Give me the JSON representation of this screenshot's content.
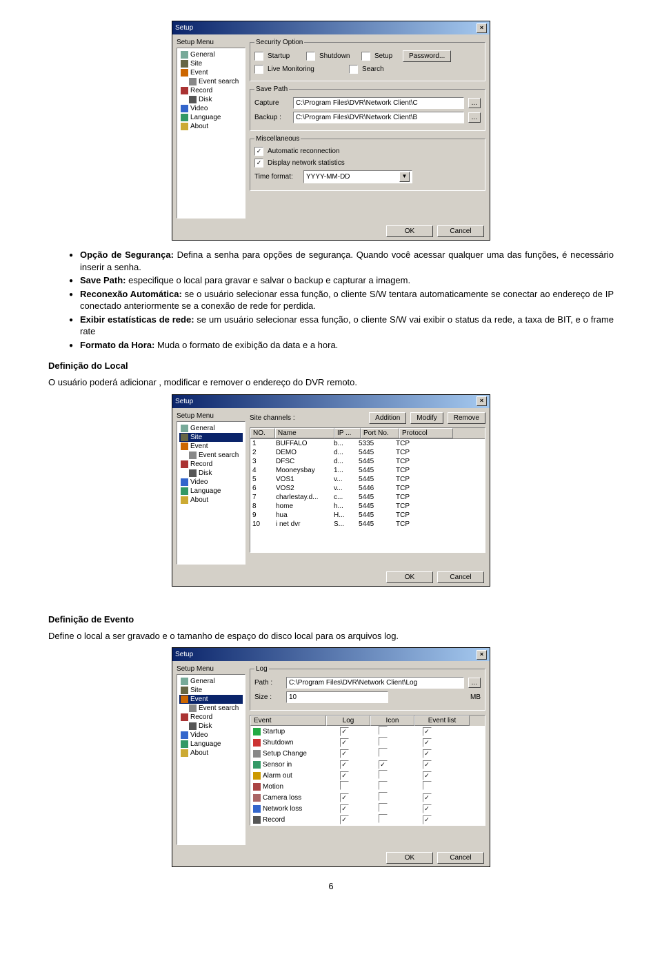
{
  "dialog_title": "Setup",
  "setup_menu_label": "Setup Menu",
  "menu_items": [
    "General",
    "Site",
    "Event",
    "Event search",
    "Record",
    "Disk",
    "Video",
    "Language",
    "About"
  ],
  "d1": {
    "security_legend": "Security Option",
    "startup": "Startup",
    "shutdown": "Shutdown",
    "setup": "Setup",
    "password_btn": "Password...",
    "live_mon": "Live Monitoring",
    "search": "Search",
    "savepath_legend": "Save Path",
    "capture": "Capture",
    "capture_path": "C:\\Program Files\\DVR\\Network Client\\C",
    "backup": "Backup :",
    "backup_path": "C:\\Program Files\\DVR\\Network Client\\B",
    "misc_legend": "Miscellaneous",
    "auto_recon": "Automatic reconnection",
    "disp_net": "Display network statistics",
    "time_fmt_label": "Time format:",
    "time_fmt_val": "YYYY-MM-DD",
    "ok": "OK",
    "cancel": "Cancel",
    "browse": "..."
  },
  "bullets": {
    "b1_head": "Opção de Segurança:",
    "b1_text": " Defina a senha para opções de segurança. Quando você acessar qualquer uma das funções, é necessário inserir a senha.",
    "b2_head": "Save Path:",
    "b2_text": " especifique o local para gravar e salvar o backup e capturar a imagem.",
    "b3_head": "Reconexão Automática:",
    "b3_text": " se o usuário selecionar essa função, o cliente S/W tentara automaticamente se conectar ao endereço de IP conectado anteriormente se a conexão de rede for perdida.",
    "b4_head": "Exibir estatísticas de rede:",
    "b4_text": " se um usuário selecionar essa função, o cliente S/W vai exibir o status da rede, a taxa de BIT, e o frame rate",
    "b5_head": "Formato da Hora:",
    "b5_text": " Muda o formato de exibição da data e a hora."
  },
  "sect1_title": "Definição do Local",
  "sect1_text": "O usuário poderá adicionar , modificar  e remover o endereço do DVR remoto.",
  "d2": {
    "sc_label": "Site channels :",
    "addition": "Addition",
    "modify": "Modify",
    "remove": "Remove",
    "cols": [
      "NO.",
      "Name",
      "IP ...",
      "Port No.",
      "Protocol"
    ],
    "rows": [
      [
        "1",
        "BUFFALO",
        "b...",
        "5335",
        "TCP"
      ],
      [
        "2",
        "DEMO",
        "d...",
        "5445",
        "TCP"
      ],
      [
        "3",
        "DFSC",
        "d...",
        "5445",
        "TCP"
      ],
      [
        "4",
        "Mooneysbay",
        "1...",
        "5445",
        "TCP"
      ],
      [
        "5",
        "VOS1",
        "v...",
        "5445",
        "TCP"
      ],
      [
        "6",
        "VOS2",
        "v...",
        "5446",
        "TCP"
      ],
      [
        "7",
        "charlestay.d...",
        "c...",
        "5445",
        "TCP"
      ],
      [
        "8",
        "home",
        "h...",
        "5445",
        "TCP"
      ],
      [
        "9",
        "hua",
        "H...",
        "5445",
        "TCP"
      ],
      [
        "10",
        "i net dvr",
        "S...",
        "5445",
        "TCP"
      ]
    ]
  },
  "sect2_title": "Definição de Evento",
  "sect2_text": "Define  o local a ser gravado e o tamanho de espaço do disco local para os arquivos log.",
  "d3": {
    "log_legend": "Log",
    "path_label": "Path :",
    "path_val": "C:\\Program Files\\DVR\\Network Client\\Log",
    "size_label": "Size :",
    "size_val": "10",
    "mb": "MB",
    "headers": [
      "Event",
      "Log",
      "Icon",
      "Event list"
    ],
    "events": [
      {
        "name": "Startup",
        "log": true,
        "icon": false,
        "list": true
      },
      {
        "name": "Shutdown",
        "log": true,
        "icon": false,
        "list": true
      },
      {
        "name": "Setup Change",
        "log": true,
        "icon": false,
        "list": true
      },
      {
        "name": "Sensor in",
        "log": true,
        "icon": true,
        "list": true
      },
      {
        "name": "Alarm out",
        "log": true,
        "icon": false,
        "list": true
      },
      {
        "name": "Motion",
        "log": false,
        "icon": false,
        "list": false
      },
      {
        "name": "Camera loss",
        "log": true,
        "icon": false,
        "list": true
      },
      {
        "name": "Network loss",
        "log": true,
        "icon": false,
        "list": true
      },
      {
        "name": "Record",
        "log": true,
        "icon": false,
        "list": true
      }
    ]
  },
  "page_num": "6",
  "icons": {
    "general": "#7a9",
    "site": "#664",
    "event": "#c60",
    "evsearch": "#888",
    "record": "#a33",
    "disk": "#555",
    "video": "#36c",
    "language": "#396",
    "about": "#ca3",
    "startup": "#2a4",
    "shutdown": "#c33",
    "setup": "#888",
    "sensor": "#396",
    "alarm": "#c90",
    "motion": "#a44",
    "camloss": "#a66",
    "netloss": "#36c",
    "recordev": "#555"
  }
}
